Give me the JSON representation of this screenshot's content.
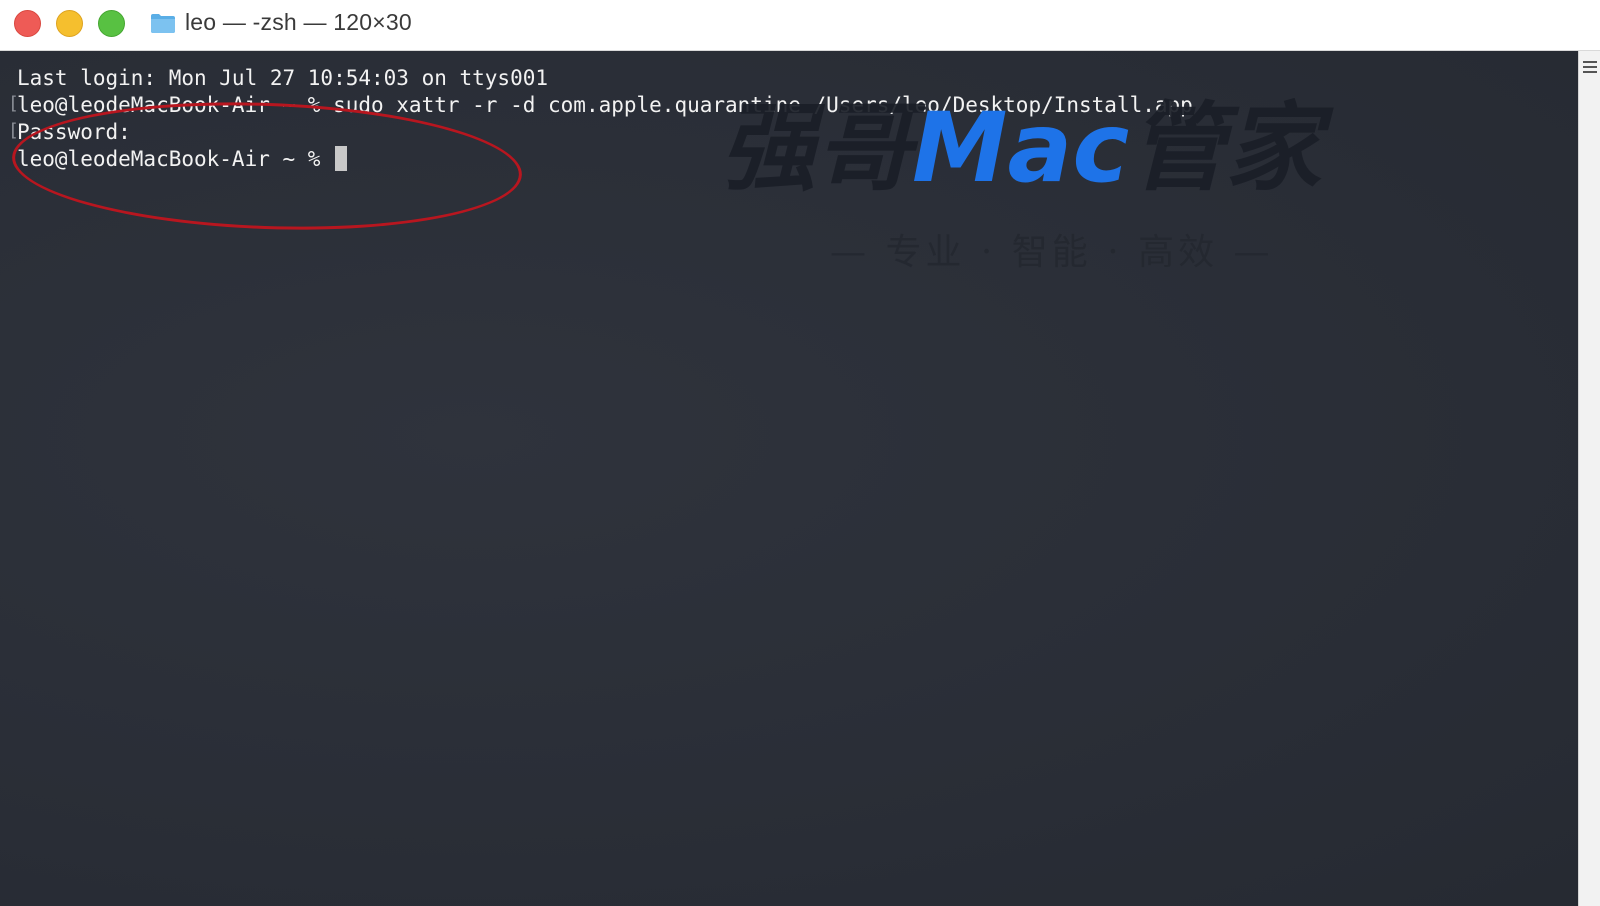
{
  "window": {
    "title": "leo — -zsh — 120×30",
    "traffic_lights": {
      "close_color": "#ee5b56",
      "minimize_color": "#f5bf2e",
      "maximize_color": "#58c142"
    },
    "title_icon": "folder-icon"
  },
  "terminal": {
    "lines": [
      "Last login: Mon Jul 27 10:54:03 on ttys001",
      "leo@leodeMacBook-Air ~ % sudo xattr -r -d com.apple.quarantine /Users/leo/Desktop/Install.app",
      "Password:",
      "leo@leodeMacBook-Air ~ % "
    ],
    "background_color": "#2b2f38",
    "text_color": "#f2f2f2"
  },
  "annotation": {
    "shape": "ellipse",
    "color": "#b8161f"
  },
  "watermark": {
    "cn_left": "强哥",
    "mac": "Mac",
    "cn_right": "管家",
    "subtitle": "— 专业 · 智能 · 高效 —",
    "accent_color": "#1e73e8"
  }
}
